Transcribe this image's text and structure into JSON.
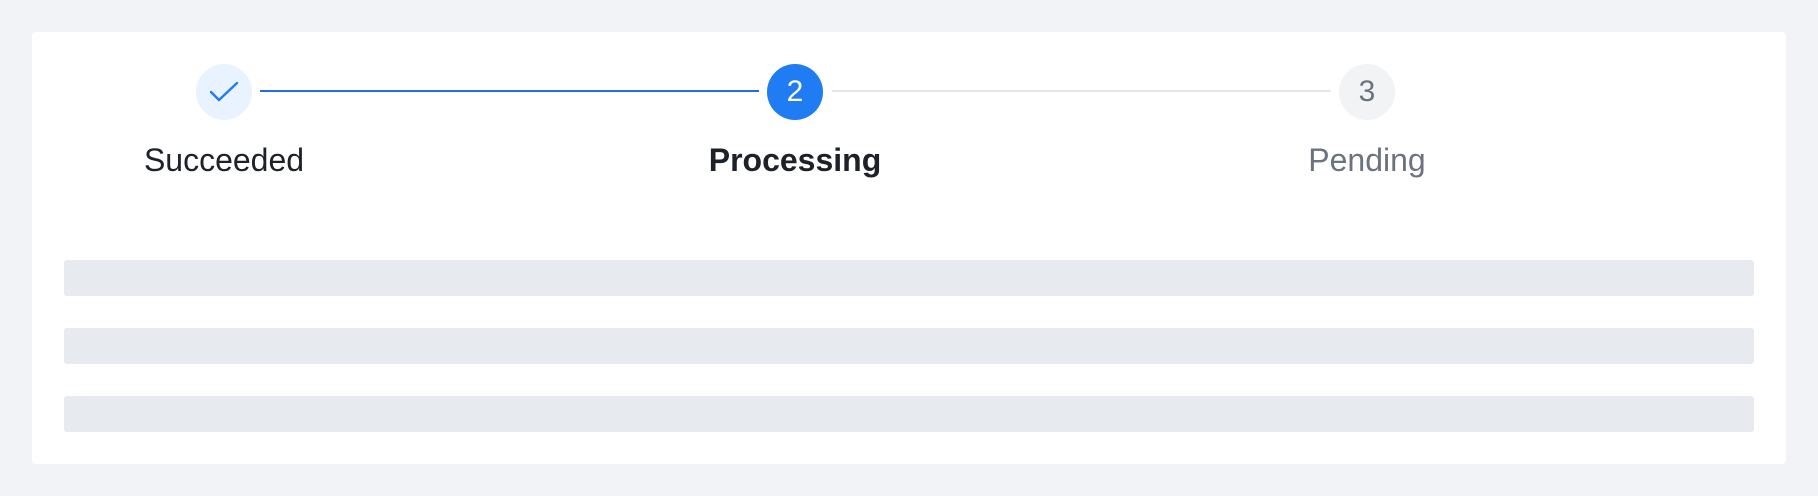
{
  "steps": [
    {
      "label": "Succeeded",
      "status": "finish",
      "icon": "check-icon"
    },
    {
      "label": "Processing",
      "status": "process",
      "number": "2"
    },
    {
      "label": "Pending",
      "status": "wait",
      "number": "3"
    }
  ],
  "colors": {
    "primary": "#1f7cf2",
    "primary_light": "#e8f3ff",
    "text_primary": "#1d2129",
    "text_secondary": "#6b7280",
    "line_inactive": "#e5e6eb",
    "skeleton": "#e7eaee",
    "background": "#f2f3f7"
  }
}
